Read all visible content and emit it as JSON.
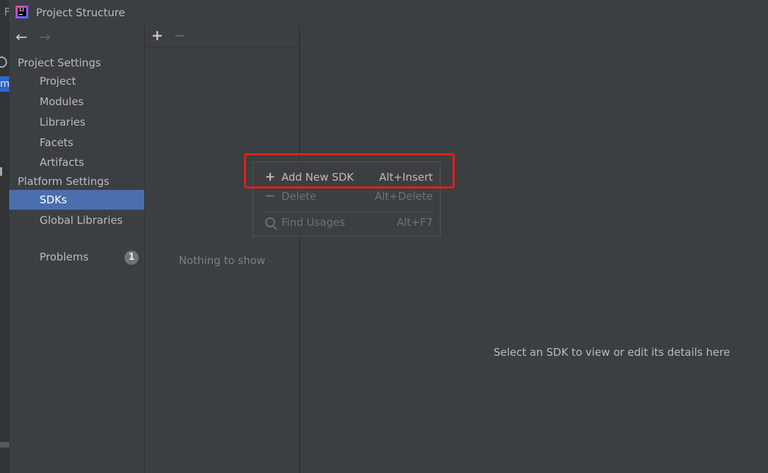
{
  "window": {
    "title": "Project Structure",
    "app_icon": "intellij-idea-icon",
    "underlying_fragments": {
      "menu_letter": "F",
      "item_letter": "m"
    }
  },
  "nav": {
    "back_icon": "arrow-left-icon",
    "forward_icon": "arrow-right-icon",
    "back_glyph": "←",
    "forward_glyph": "→"
  },
  "sidebar": {
    "project_settings_header": "Project Settings",
    "platform_settings_header": "Platform Settings",
    "project_items": [
      {
        "label": "Project"
      },
      {
        "label": "Modules"
      },
      {
        "label": "Libraries"
      },
      {
        "label": "Facets"
      },
      {
        "label": "Artifacts"
      }
    ],
    "platform_items": [
      {
        "label": "SDKs",
        "selected": true
      },
      {
        "label": "Global Libraries",
        "selected": false
      }
    ],
    "problems": {
      "label": "Problems",
      "count": "1"
    }
  },
  "list_panel": {
    "add_glyph": "+",
    "remove_glyph": "−",
    "empty_text": "Nothing to show"
  },
  "popup_menu": {
    "items": [
      {
        "icon": "plus-icon",
        "glyph": "+",
        "label": "Add New SDK",
        "shortcut": "Alt+Insert",
        "enabled": true
      },
      {
        "icon": "minus-icon",
        "glyph": "−",
        "label": "Delete",
        "shortcut": "Alt+Delete",
        "enabled": false
      },
      {
        "icon": "search-icon",
        "glyph": "",
        "label": "Find Usages",
        "shortcut": "Alt+F7",
        "enabled": false
      }
    ]
  },
  "details": {
    "empty_text": "Select an SDK to view or edit its details here"
  },
  "colors": {
    "background": "#3c3f41",
    "selection": "#4b6eaf",
    "highlight_border": "#e0201c",
    "text": "#bbbbbb",
    "disabled_text": "#6e7174"
  }
}
